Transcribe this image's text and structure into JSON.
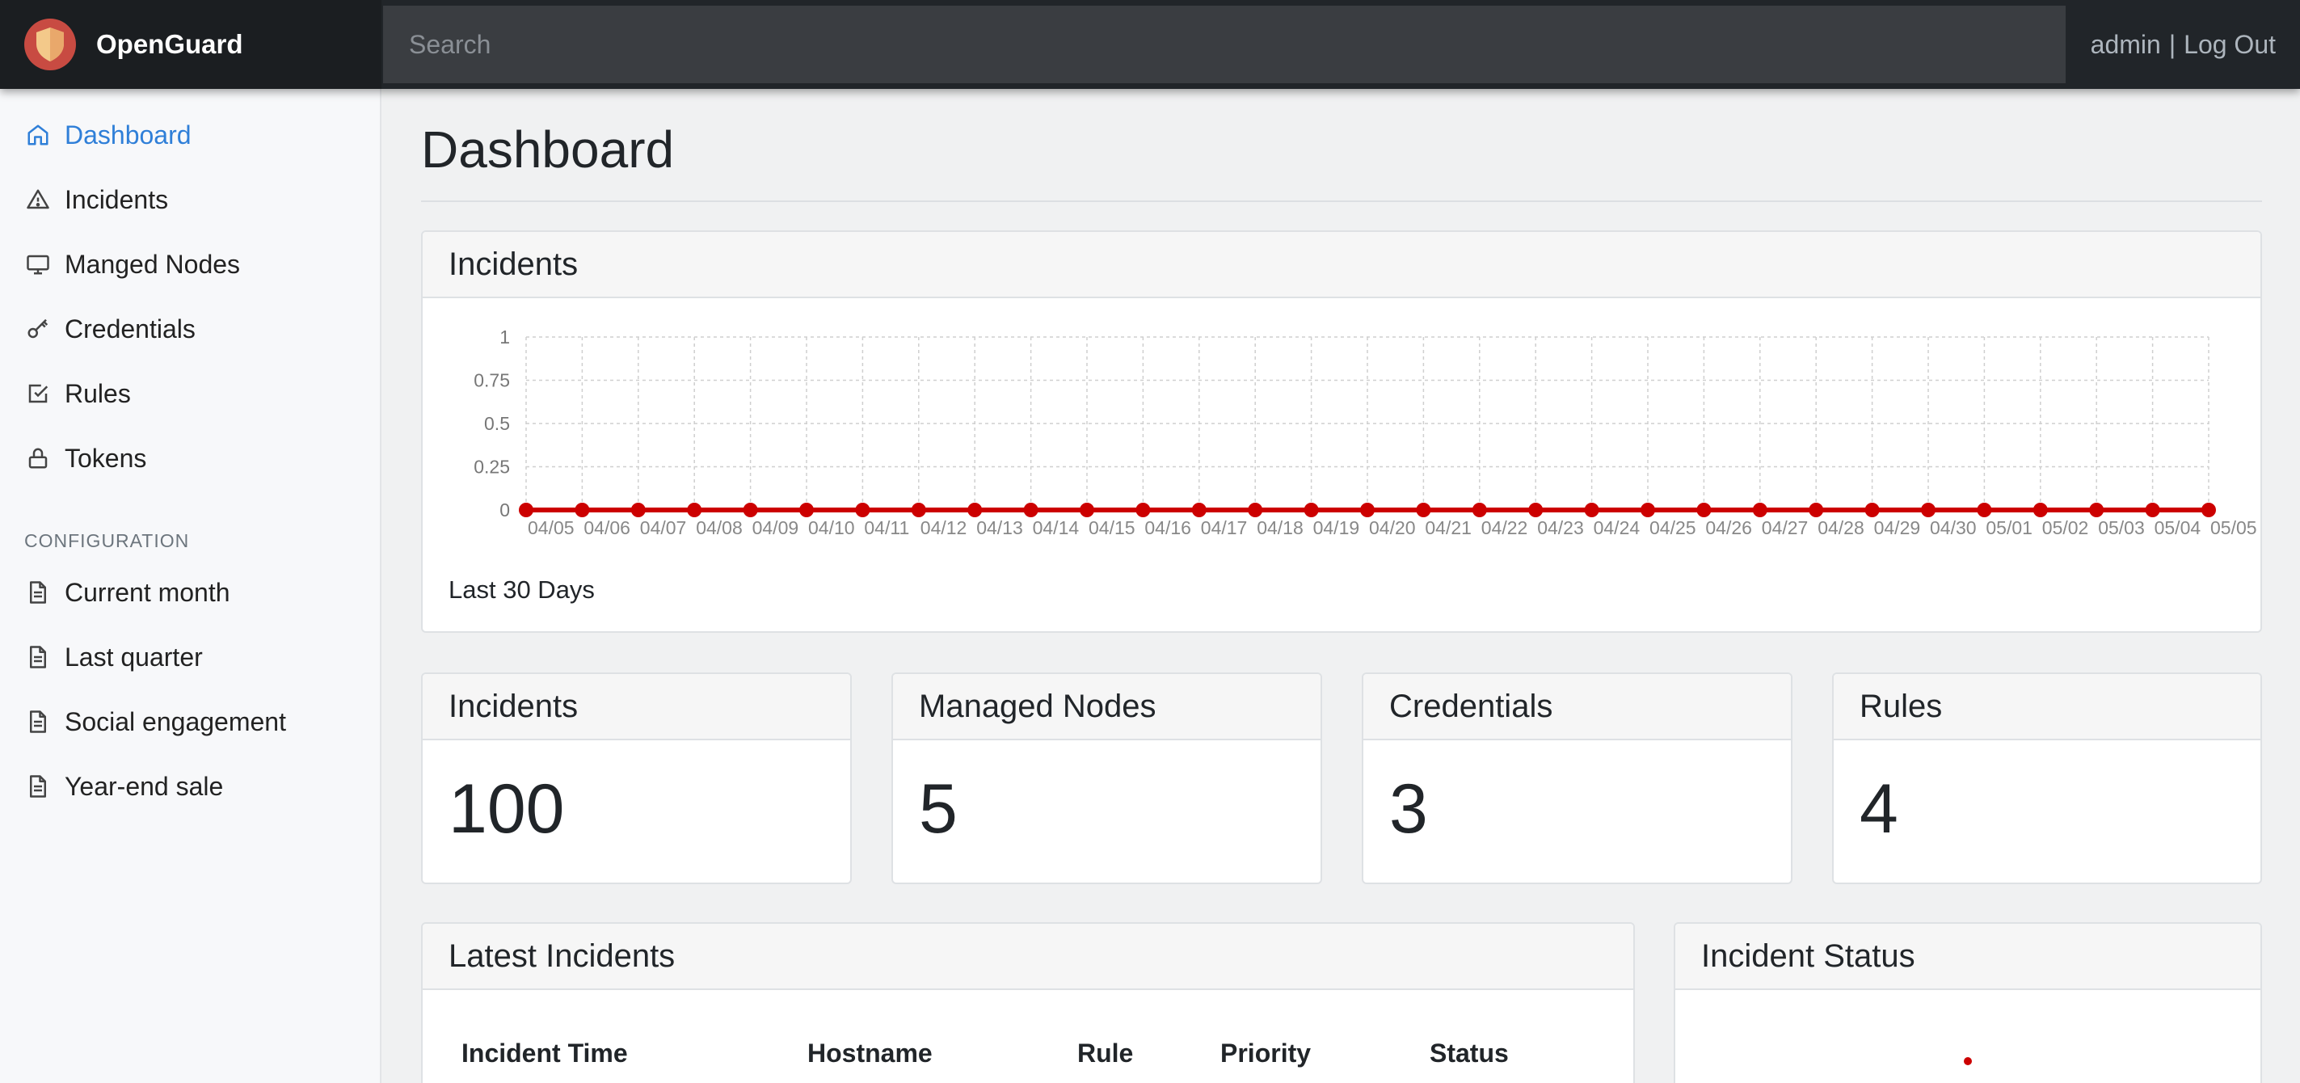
{
  "app": {
    "name": "OpenGuard"
  },
  "search": {
    "placeholder": "Search"
  },
  "user": {
    "name": "admin",
    "separator": "|",
    "logout": "Log Out"
  },
  "sidebar": {
    "items": [
      {
        "label": "Dashboard",
        "icon": "home-icon",
        "active": true
      },
      {
        "label": "Incidents",
        "icon": "alert-triangle-icon"
      },
      {
        "label": "Manged Nodes",
        "icon": "monitor-icon"
      },
      {
        "label": "Credentials",
        "icon": "key-icon"
      },
      {
        "label": "Rules",
        "icon": "check-square-icon"
      },
      {
        "label": "Tokens",
        "icon": "lock-icon"
      }
    ],
    "section_heading": "CONFIGURATION",
    "config_items": [
      {
        "label": "Current month",
        "icon": "file-text-icon"
      },
      {
        "label": "Last quarter",
        "icon": "file-text-icon"
      },
      {
        "label": "Social engagement",
        "icon": "file-text-icon"
      },
      {
        "label": "Year-end sale",
        "icon": "file-text-icon"
      }
    ]
  },
  "page": {
    "title": "Dashboard"
  },
  "incidents_chart": {
    "header": "Incidents",
    "footer": "Last 30 Days"
  },
  "chart_data": {
    "type": "line",
    "x": [
      "04/05",
      "04/06",
      "04/07",
      "04/08",
      "04/09",
      "04/10",
      "04/11",
      "04/12",
      "04/13",
      "04/14",
      "04/15",
      "04/16",
      "04/17",
      "04/18",
      "04/19",
      "04/20",
      "04/21",
      "04/22",
      "04/23",
      "04/24",
      "04/25",
      "04/26",
      "04/27",
      "04/28",
      "04/29",
      "04/30",
      "05/01",
      "05/02",
      "05/03",
      "05/04",
      "05/05"
    ],
    "series": [
      {
        "values": [
          0,
          0,
          0,
          0,
          0,
          0,
          0,
          0,
          0,
          0,
          0,
          0,
          0,
          0,
          0,
          0,
          0,
          0,
          0,
          0,
          0,
          0,
          0,
          0,
          0,
          0,
          0,
          0,
          0,
          0,
          0
        ],
        "color": "#cc0000"
      }
    ],
    "y_ticks": [
      "0",
      "0.25",
      "0.5",
      "0.75",
      "1"
    ],
    "ylim": [
      0,
      1
    ],
    "grid": true,
    "legend": "none"
  },
  "stats": [
    {
      "label": "Incidents",
      "value": "100"
    },
    {
      "label": "Managed Nodes",
      "value": "5"
    },
    {
      "label": "Credentials",
      "value": "3"
    },
    {
      "label": "Rules",
      "value": "4"
    }
  ],
  "latest_incidents": {
    "header": "Latest Incidents",
    "columns": [
      "Incident Time",
      "Hostname",
      "Rule",
      "Priority",
      "Status"
    ]
  },
  "incident_status": {
    "header": "Incident Status"
  },
  "colors": {
    "accent": "#2f7fd8",
    "navbar": "#212529",
    "chart_line": "#cc0000",
    "logo": "#c84b42"
  }
}
